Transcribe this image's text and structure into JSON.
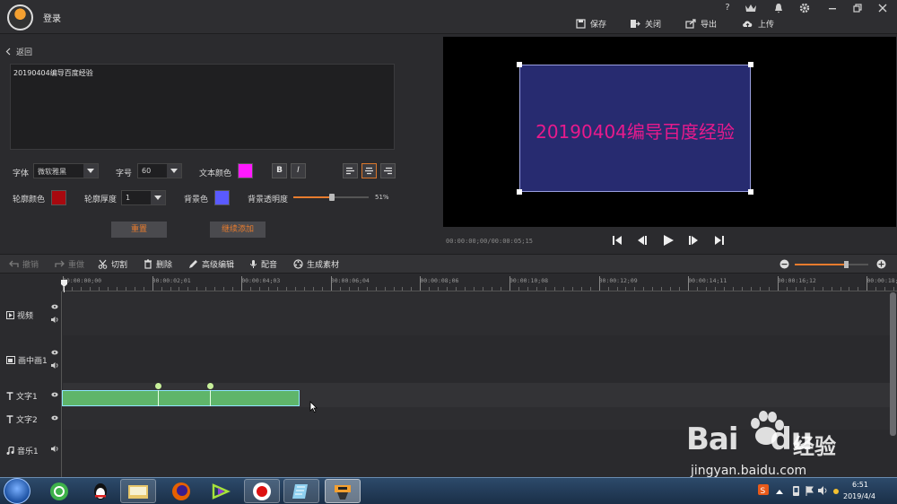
{
  "titlebar": {
    "login_label": "登录",
    "save": "保存",
    "close": "关闭",
    "export": "导出",
    "upload": "上传",
    "help_glyph": "?"
  },
  "editor": {
    "back_label": "返回",
    "text_value": "20190404编导百度经验",
    "font_label": "字体",
    "font_value": "微软雅黑",
    "size_label": "字号",
    "size_value": "60",
    "text_color_label": "文本颜色",
    "text_color": "#ff1aff",
    "bold": "B",
    "italic": "I",
    "outline_color_label": "轮廓颜色",
    "outline_color": "#a8090f",
    "outline_width_label": "轮廓厚度",
    "outline_width_value": "1",
    "bg_color_label": "背景色",
    "bg_color": "#5a5aff",
    "bg_opacity_label": "背景透明度",
    "bg_opacity_value": "51%",
    "bg_opacity_fraction": 0.51,
    "reset_label": "重置",
    "continue_label": "继续添加"
  },
  "preview": {
    "caption": "20190404编导百度经验",
    "timecode": "00:00:00;00/00:00:05;15"
  },
  "toolbar": {
    "undo": "撤销",
    "redo": "重做",
    "cut": "切割",
    "delete": "删除",
    "advanced_edit": "高级编辑",
    "dub": "配音",
    "generate": "生成素材",
    "zoom_fraction": 0.7
  },
  "ruler": {
    "ticks": [
      "00:00:00;00",
      "00:00:02;01",
      "00:00:04;03",
      "00:00:06;04",
      "00:00:08;06",
      "00:00:10;08",
      "00:00:12;09",
      "00:00:14;11",
      "00:00:16;12",
      "00:00:18;"
    ]
  },
  "tracks": [
    {
      "name": "视频",
      "icon": "video-icon"
    },
    {
      "name": "画中画1",
      "icon": "pip-icon"
    },
    {
      "name": "文字1",
      "icon": "text-icon"
    },
    {
      "name": "文字2",
      "icon": "text-icon"
    },
    {
      "name": "音乐1",
      "icon": "music-icon"
    }
  ],
  "taskbar": {
    "time": "6:51",
    "date": "2019/4/4"
  },
  "watermark": {
    "logo_text": "Bai",
    "logo_text2": "du",
    "cn": "经验",
    "url": "jingyan.baidu.com"
  },
  "colors": {
    "accent": "#e87c2e",
    "clip": "#5fb56a",
    "preview_bg": "#272b70",
    "caption": "#e81a8c"
  }
}
